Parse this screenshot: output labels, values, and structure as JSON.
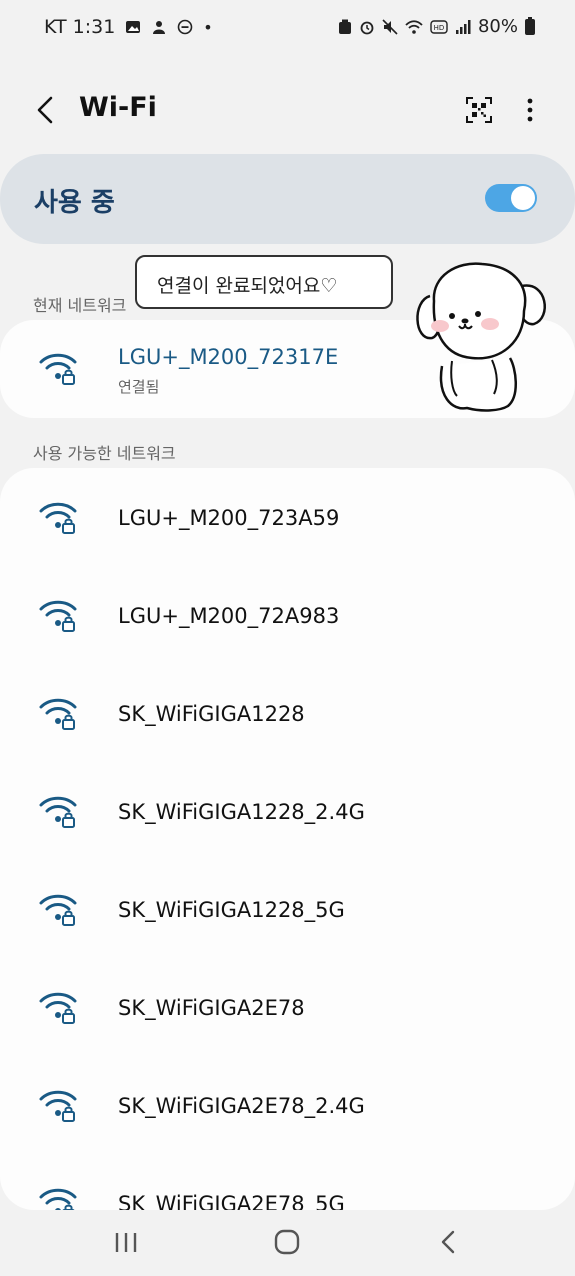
{
  "status_bar": {
    "carrier_time": "KT 1:31",
    "dot": "•",
    "battery": "80%"
  },
  "app_bar": {
    "title": "Wi-Fi"
  },
  "master": {
    "label": "사용 중",
    "enabled": true
  },
  "current_section": {
    "label": "현재 네트워크"
  },
  "current_network": {
    "name": "LGU+_M200_72317E",
    "status": "연결됨"
  },
  "available_section": {
    "label": "사용 가능한 네트워크"
  },
  "available_networks": [
    {
      "name": "LGU+_M200_723A59"
    },
    {
      "name": "LGU+_M200_72A983"
    },
    {
      "name": "SK_WiFiGIGA1228"
    },
    {
      "name": "SK_WiFiGIGA1228_2.4G"
    },
    {
      "name": "SK_WiFiGIGA1228_5G"
    },
    {
      "name": "SK_WiFiGIGA2E78"
    },
    {
      "name": "SK_WiFiGIGA2E78_2.4G"
    },
    {
      "name": "SK_WiFiGIGA2E78_5G"
    }
  ],
  "tooltip": {
    "text": "연결이 완료되었어요♡"
  },
  "colors": {
    "accent": "#1a5a85",
    "toggle": "#4da6e5",
    "card": "#dde2e7"
  }
}
